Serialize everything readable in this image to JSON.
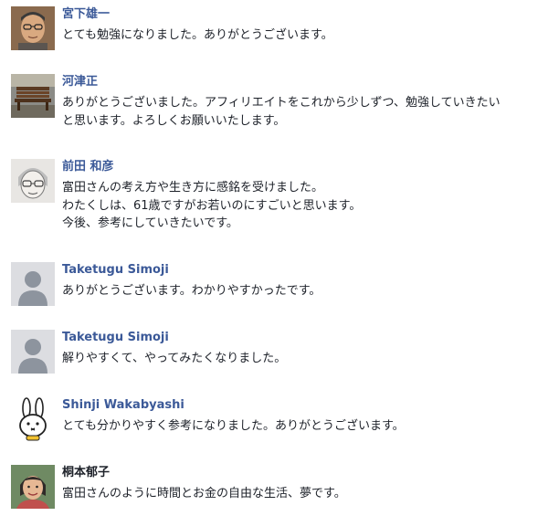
{
  "comments": [
    {
      "name": "宮下雄一",
      "avatar": "photo-man-glasses-icon",
      "lines": [
        "とても勉強になりました。ありがとうございます。"
      ]
    },
    {
      "name": "河津正",
      "avatar": "photo-bench-icon",
      "lines": [
        "ありがとうございました。アフィリエイトをこれから少しずつ、勉強していきたい",
        "と思います。よろしくお願いいたします。"
      ]
    },
    {
      "name": "前田 和彦",
      "avatar": "illustrated-face-icon",
      "lines": [
        "富田さんの考え方や生き方に感銘を受けました。",
        "わたくしは、61歳ですがお若いのにすごいと思います。",
        "今後、参考にしていきたいです。"
      ]
    },
    {
      "name": "Taketugu Simoji",
      "avatar": "default-user-icon",
      "lines": [
        "ありがとうございます。わかりやすかったです。"
      ]
    },
    {
      "name": "Taketugu Simoji",
      "avatar": "default-user-icon",
      "lines": [
        "解りやすくて、やってみたくなりました。"
      ]
    },
    {
      "name": "Shinji Wakabyashi",
      "avatar": "rabbit-character-icon",
      "lines": [
        "とても分かりやすく参考になりました。ありがとうございます。"
      ]
    },
    {
      "name": "桐本郁子",
      "avatar": "photo-woman-icon",
      "lines": [
        "富田さんのように時間とお金の自由な生活、夢です。"
      ]
    }
  ],
  "colors": {
    "name_link": "#3b5998",
    "name_dark": "#1d2129",
    "text": "#1d2129",
    "avatar_placeholder_bg": "#dcdde1",
    "avatar_placeholder_fg": "#8d949e"
  }
}
